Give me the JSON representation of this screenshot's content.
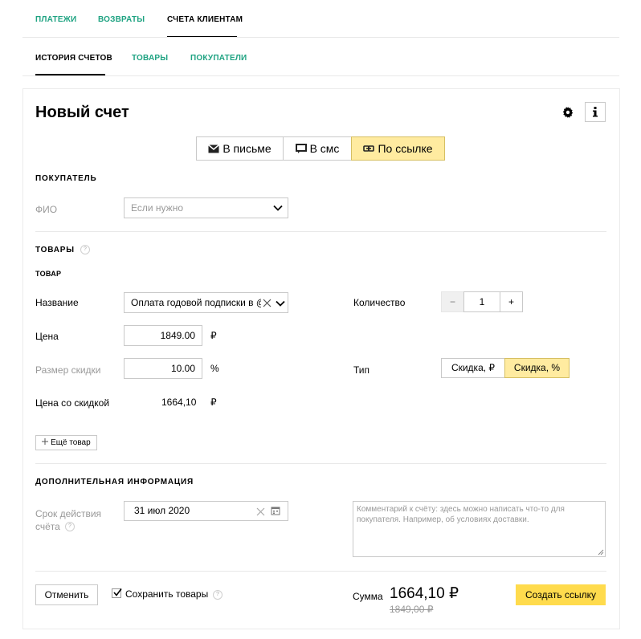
{
  "top_nav": {
    "tabs": [
      "ПЛАТЕЖИ",
      "ВОЗВРАТЫ",
      "СЧЕТА КЛИЕНТАМ"
    ]
  },
  "sub_nav": {
    "tabs": [
      "ИСТОРИЯ СЧЕТОВ",
      "ТОВАРЫ",
      "ПОКУПАТЕЛИ"
    ]
  },
  "form": {
    "title": "Новый счет",
    "delivery": {
      "options": [
        "В письме",
        "В смс",
        "По ссылке"
      ],
      "selected": "По ссылке"
    },
    "buyer": {
      "section": "ПОКУПАТЕЛЬ",
      "name_label": "ФИО",
      "name_placeholder": "Если нужно"
    },
    "goods": {
      "section": "ТОВАРЫ",
      "help_icon": "?",
      "item_title": "ТОВАР",
      "name_label": "Название",
      "name_value": "Оплата годовой подписки в @",
      "price_label": "Цена",
      "price_value": "1849.00",
      "currency": "₽",
      "discount_label": "Размер скидки",
      "discount_value": "10.00",
      "percent": "%",
      "discounted_label": "Цена со скидкой",
      "discounted_value": "1664,10",
      "qty_label": "Количество",
      "qty_minus": "−",
      "qty_value": "1",
      "qty_plus": "+",
      "type_label": "Тип",
      "type_options": [
        "Скидка, ₽",
        "Скидка, %"
      ],
      "type_selected": "Скидка, %",
      "add_more": "Ещё товар"
    },
    "extra": {
      "section": "ДОПОЛНИТЕЛЬНАЯ ИНФОРМАЦИЯ",
      "validity_label_1": "Срок действия",
      "validity_label_2": "счёта",
      "date_value": "31 июл 2020",
      "comment_placeholder": "Комментарий к счёту: здесь можно написать что-то для покупателя. Например, об условиях доставки."
    },
    "footer": {
      "cancel": "Отменить",
      "save_goods": "Сохранить товары",
      "save_goods_checked": true,
      "sum_label": "Сумма",
      "sum_value": "1664,10 ₽",
      "old_sum": "1849,00 ₽",
      "create": "Создать ссылку"
    }
  },
  "colors": {
    "accent_green": "#1fa382",
    "selected_yellow": "#ffeba0",
    "primary_yellow": "#ffdb4d"
  },
  "icons": [
    "gear-icon",
    "info-icon",
    "envelope-icon",
    "sms-icon",
    "link-icon",
    "chevron-down-icon",
    "clear-icon",
    "calendar-icon",
    "plus-icon",
    "help-icon",
    "checkbox-checked-icon"
  ]
}
